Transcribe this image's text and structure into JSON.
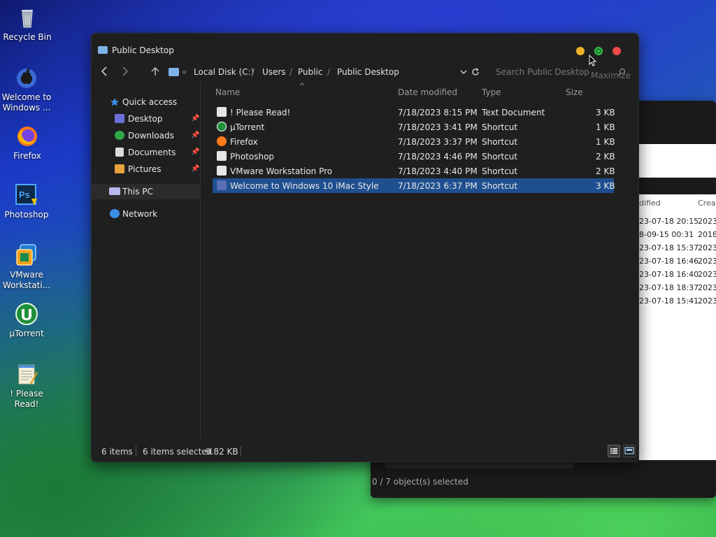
{
  "desktop": {
    "icons": [
      {
        "label": "Recycle Bin",
        "icon": "recycle-bin-icon"
      },
      {
        "label": "Welcome to\nWindows ...",
        "icon": "apple-logo-icon"
      },
      {
        "label": "Firefox",
        "icon": "firefox-icon"
      },
      {
        "label": "Photoshop",
        "icon": "photoshop-icon"
      },
      {
        "label": "VMware\nWorkstati...",
        "icon": "vmware-icon"
      },
      {
        "label": "μTorrent",
        "icon": "utorrent-icon"
      },
      {
        "label": "! Please Read!",
        "icon": "notepad-icon"
      }
    ]
  },
  "back_window": {
    "column_partial_1": "dified",
    "column_partial_2": "Crea",
    "rows": [
      {
        "modified": "23-07-18 20:15",
        "created": "2023-"
      },
      {
        "modified": "8-09-15 00:31",
        "created": "2018-"
      },
      {
        "modified": "23-07-18 15:37",
        "created": "2023-"
      },
      {
        "modified": "23-07-18 16:46",
        "created": "2023-"
      },
      {
        "modified": "23-07-18 16:40",
        "created": "2023-"
      },
      {
        "modified": "23-07-18 18:37",
        "created": "2023-"
      },
      {
        "modified": "23-07-18 15:41",
        "created": "2023-"
      }
    ],
    "status": "0 / 7 object(s) selected"
  },
  "window": {
    "title": "Public Desktop",
    "colors": {
      "minimize": "#f0b429",
      "maximize": "#2fbd4a",
      "close": "#ef4a4a",
      "selection": "#1f4f8f"
    },
    "nav": {
      "chevrons": "«",
      "breadcrumb": [
        "Local Disk (C:)",
        "Users",
        "Public",
        "Public Desktop"
      ],
      "separator": "/",
      "search_placeholder": "Search Public Desktop",
      "tooltip": "Maximize"
    },
    "sidebar": {
      "quick_access": "Quick access",
      "items": [
        {
          "label": "Desktop",
          "icon": "desktop-icon",
          "pinned": true
        },
        {
          "label": "Downloads",
          "icon": "downloads-icon",
          "pinned": true
        },
        {
          "label": "Documents",
          "icon": "documents-icon",
          "pinned": true
        },
        {
          "label": "Pictures",
          "icon": "pictures-icon",
          "pinned": true
        }
      ],
      "this_pc": "This PC",
      "network": "Network"
    },
    "columns": {
      "name": "Name",
      "date_modified": "Date modified",
      "type": "Type",
      "size": "Size"
    },
    "files": [
      {
        "name": "! Please Read!",
        "date": "7/18/2023 8:15 PM",
        "type": "Text Document",
        "size": "3 KB",
        "icon": "text-file-icon",
        "selected": false
      },
      {
        "name": "μTorrent",
        "date": "7/18/2023 3:41 PM",
        "type": "Shortcut",
        "size": "1 KB",
        "icon": "utorrent-icon",
        "selected": false
      },
      {
        "name": "Firefox",
        "date": "7/18/2023 3:37 PM",
        "type": "Shortcut",
        "size": "1 KB",
        "icon": "firefox-icon",
        "selected": false
      },
      {
        "name": "Photoshop",
        "date": "7/18/2023 4:46 PM",
        "type": "Shortcut",
        "size": "2 KB",
        "icon": "shortcut-icon",
        "selected": false
      },
      {
        "name": "VMware Workstation Pro",
        "date": "7/18/2023 4:40 PM",
        "type": "Shortcut",
        "size": "2 KB",
        "icon": "shortcut-icon",
        "selected": false
      },
      {
        "name": "Welcome to Windows 10 iMac Style",
        "date": "7/18/2023 6:37 PM",
        "type": "Shortcut",
        "size": "3 KB",
        "icon": "shortcut-icon",
        "selected": true
      }
    ],
    "status": {
      "item_count": "6 items",
      "selected": "6 items selected",
      "size": "9.82 KB"
    }
  }
}
